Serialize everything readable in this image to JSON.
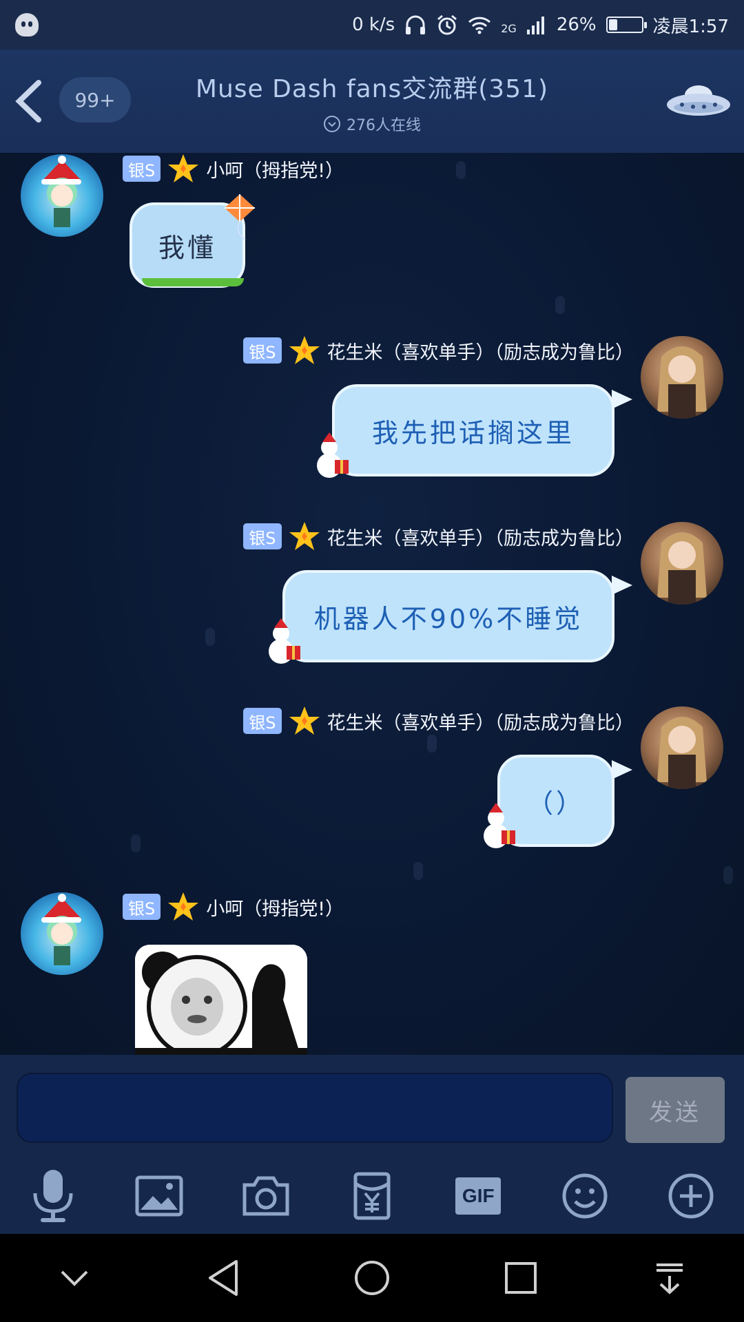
{
  "status_bar": {
    "net_speed": "0 k/s",
    "network": "2G",
    "battery": "26%",
    "battery_level": 0.26,
    "time": "凌晨1:57"
  },
  "header": {
    "unread": "99+",
    "title": "Muse Dash fans交流群(351)",
    "online": "276人在线"
  },
  "messages": [
    {
      "side": "left",
      "rank": "银S",
      "name": "小呵（拇指党!）",
      "text": "我懂"
    },
    {
      "side": "right",
      "rank": "银S",
      "name": "花生米（喜欢单手）（励志成为鲁比）",
      "text": "我先把话搁这里"
    },
    {
      "side": "right",
      "rank": "银S",
      "name": "花生米（喜欢单手）（励志成为鲁比）",
      "text": "机器人不90%不睡觉"
    },
    {
      "side": "right",
      "rank": "银S",
      "name": "花生米（喜欢单手）（励志成为鲁比）",
      "text": "（）"
    },
    {
      "side": "left",
      "rank": "银S",
      "name": "小呵（拇指党!）",
      "image": "panda-meme"
    }
  ],
  "input": {
    "placeholder": "",
    "value": ""
  },
  "send_label": "发送",
  "toolbar": {
    "gif_label": "GIF"
  },
  "icons": [
    "mic-icon",
    "image-icon",
    "camera-icon",
    "red-packet-icon",
    "gif-icon",
    "emoji-icon",
    "plus-icon"
  ],
  "colors": {
    "bubble": "#bfe3fb",
    "bubble_text": "#1d5fb4",
    "rank_badge": "#8fb6ff",
    "header": "#1d3562"
  }
}
